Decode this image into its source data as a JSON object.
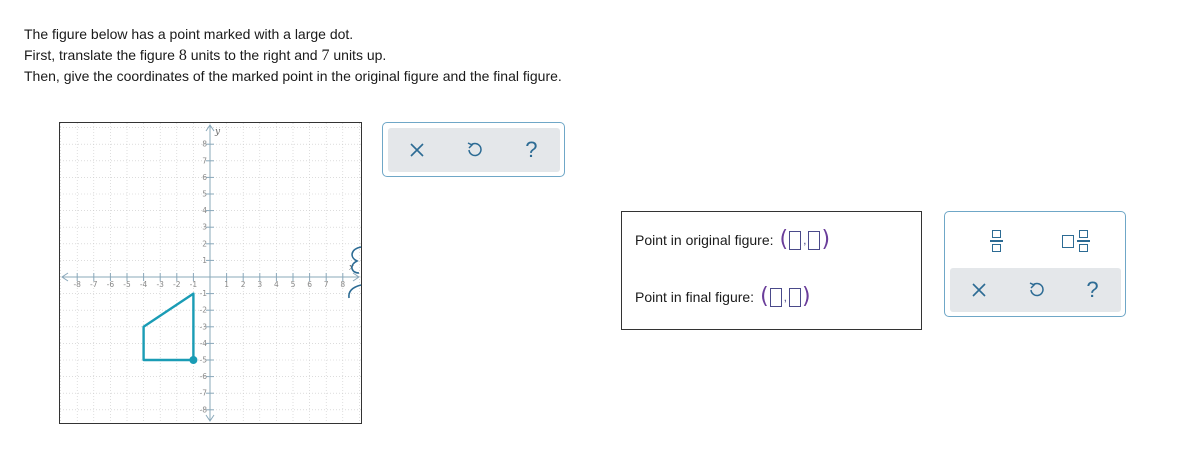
{
  "instructions": {
    "line1": "The figure below has a point marked with a large dot.",
    "line2_a": "First, translate the figure ",
    "line2_b": "8",
    "line2_c": " units to the right and ",
    "line2_d": "7",
    "line2_e": " units up.",
    "line3": "Then, give the coordinates of the marked point in the original figure and the final figure."
  },
  "graph": {
    "x_axis_label": "x",
    "y_axis_label": "y",
    "x_min": -8,
    "x_max": 8,
    "y_min": -8,
    "y_max": 8,
    "tick_labels_x": [
      "-8",
      "-7",
      "-6",
      "-5",
      "-4",
      "-3",
      "-2",
      "-1",
      "1",
      "2",
      "3",
      "4",
      "5",
      "6",
      "7",
      "8"
    ],
    "tick_labels_y": [
      "8",
      "7",
      "6",
      "5",
      "4",
      "3",
      "2",
      "1",
      "-1",
      "-2",
      "-3",
      "-4",
      "-5",
      "-6",
      "-7",
      "-8"
    ],
    "figure_vertices": [
      [
        -1,
        -1
      ],
      [
        -4,
        -3
      ],
      [
        -4,
        -5
      ],
      [
        -1,
        -5
      ]
    ],
    "marked_point": [
      -1,
      -5
    ],
    "figure_color": "#1a9cb5"
  },
  "graph_tools": {
    "clear_icon": "x-icon",
    "undo_icon": "undo-icon",
    "help_label": "?"
  },
  "answers": {
    "original_label": "Point in original figure:",
    "final_label": "Point in final figure:",
    "open_paren": "(",
    "close_paren": ")",
    "comma": ","
  },
  "answer_tools": {
    "fraction_icon": "fraction-icon",
    "mixed_number_icon": "mixed-number-icon",
    "clear_icon": "x-icon",
    "undo_icon": "undo-icon",
    "help_label": "?"
  },
  "colors": {
    "accent": "#2c6b94",
    "border": "#6fa7c7",
    "toolbar_bg": "#e4e7ea"
  }
}
